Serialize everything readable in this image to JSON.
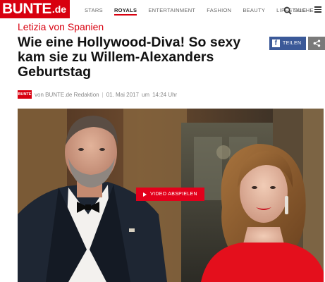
{
  "brand": {
    "logo_main": "BUNTE",
    "logo_tld": ".de",
    "accent": "#d8000f"
  },
  "nav": {
    "items": [
      {
        "label": "STARS",
        "active": false
      },
      {
        "label": "ROYALS",
        "active": true
      },
      {
        "label": "ENTERTAINMENT",
        "active": false
      },
      {
        "label": "FASHION",
        "active": false
      },
      {
        "label": "BEAUTY",
        "active": false
      },
      {
        "label": "LIFESTYLE",
        "active": false
      }
    ],
    "search_label": "SUCHE",
    "search_icon": "search-icon",
    "menu_icon": "hamburger-menu-icon"
  },
  "article": {
    "kicker": "Letizia von Spanien",
    "headline": "Wie eine Hollywood-Diva! So sexy kam sie zu Willem-Alexanders Geburtstag",
    "byline": {
      "logo": "BUNTE",
      "author": "von BUNTE.de Redaktion",
      "separator": "|",
      "date": "01. Mai 2017",
      "time_prefix": "um",
      "time": "14:24 Uhr"
    },
    "share": {
      "facebook_label": "TEILEN",
      "facebook_icon": "f",
      "facebook_color": "#3b5998"
    }
  },
  "hero": {
    "video_button_label": "VIDEO ABSPIELEN",
    "video_button_color": "#e3001b"
  }
}
